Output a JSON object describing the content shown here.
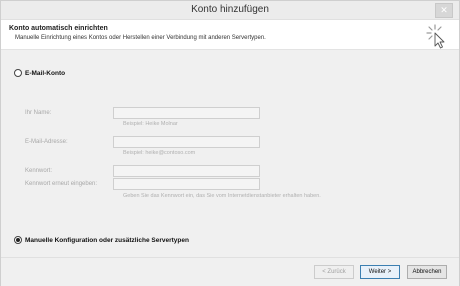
{
  "window": {
    "title": "Konto hinzufügen",
    "close_glyph": "✕"
  },
  "header": {
    "title": "Konto automatisch einrichten",
    "subtitle": "Manuelle Einrichtung eines Kontos oder Herstellen einer Verbindung mit anderen Servertypen.",
    "icon": "wizard-cursor-icon"
  },
  "options": {
    "email_account": {
      "label": "E-Mail-Konto",
      "selected": false
    },
    "manual": {
      "label": "Manuelle Konfiguration oder zusätzliche Servertypen",
      "selected": true
    }
  },
  "form": {
    "name_label": "Ihr Name:",
    "name_hint": "Beispiel: Heike Molnar",
    "email_label": "E-Mail-Adresse:",
    "email_hint": "Beispiel: heike@contoso.com",
    "password_label": "Kennwort:",
    "password_confirm_label": "Kennwort erneut eingeben:",
    "password_hint": "Geben Sie das Kennwort ein, das Sie vom Internetdienstanbieter erhalten haben."
  },
  "buttons": {
    "back": "< Zurück",
    "next": "Weiter >",
    "cancel": "Abbrechen"
  }
}
